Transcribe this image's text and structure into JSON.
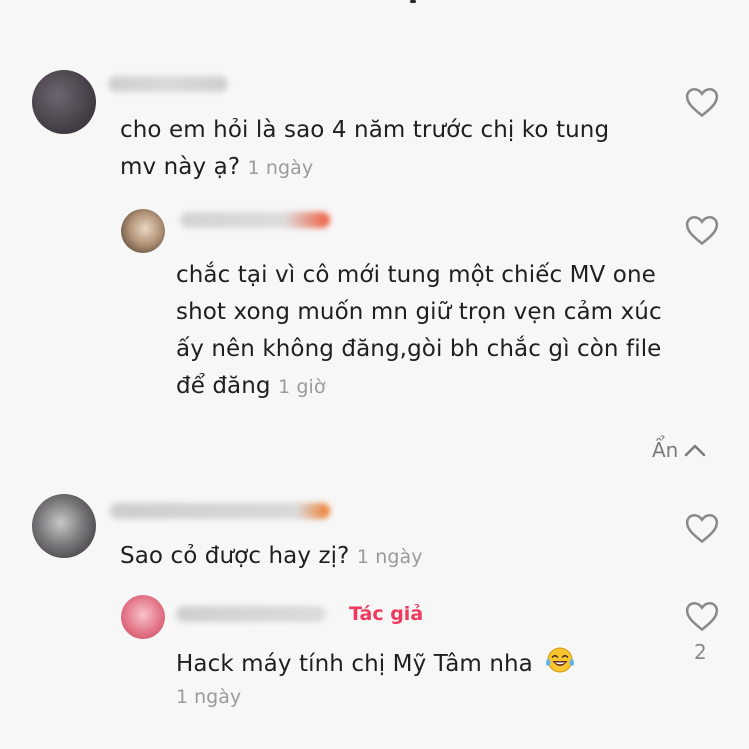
{
  "comments": [
    {
      "text": "cho em hỏi là sao 4 năm trước chị ko tung mv này ạ?",
      "time": "1 ngày"
    },
    {
      "text": "chắc tại vì cô mới tung một chiếc MV one shot xong muốn mn giữ trọn vẹn cảm xúc ấy nên không đăng,gòi bh chắc gì còn file để đăng",
      "time": "1 giờ"
    },
    {
      "text": "Sao cỏ được hay zị?",
      "time": "1 ngày"
    },
    {
      "text": "Hack máy tính chị Mỹ Tâm nha",
      "time": "1 ngày",
      "badge": "Tác giả",
      "like_count": "2"
    }
  ],
  "hide_replies_label": "Ẩn",
  "colors": {
    "author_badge": "#ef3a5d",
    "text": "#1f1f1f",
    "muted": "#9b9b9b"
  },
  "icons": {
    "like": "heart-icon",
    "collapse": "chevron-up-icon",
    "emoji": "laughing-tears-emoji"
  }
}
